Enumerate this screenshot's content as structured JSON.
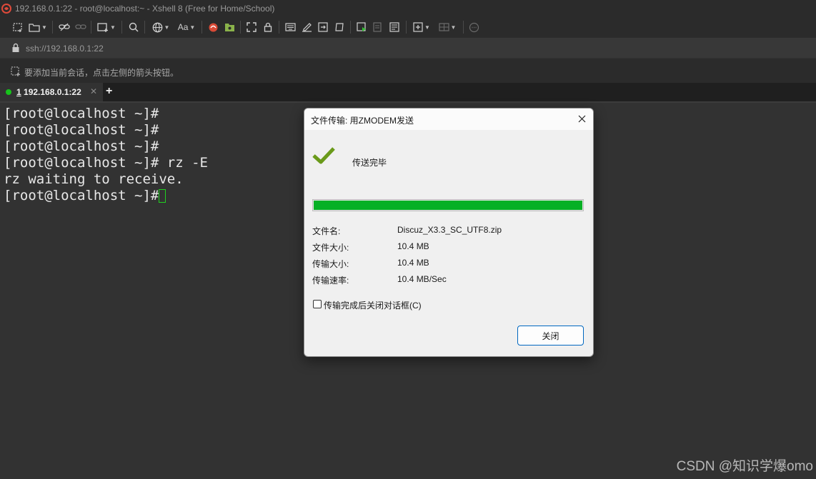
{
  "window": {
    "title": "192.168.0.1:22 - root@localhost:~ - Xshell 8 (Free for Home/School)"
  },
  "toolbar": {
    "font_label": "Aa",
    "buttons": [
      "new-session-icon",
      "open-folder-icon",
      "link-icon",
      "unlink-icon",
      "new-window-icon",
      "search-icon",
      "globe-icon",
      "font-icon",
      "xftp-icon",
      "xagent-icon",
      "fullscreen-icon",
      "lock-icon",
      "keyboard-icon",
      "compose-icon",
      "script-icon",
      "arrange-icon",
      "tunnel-icon",
      "log-icon",
      "notes-icon",
      "add-icon",
      "layout-icon",
      "chat-icon"
    ]
  },
  "addressbar": {
    "address": "ssh://192.168.0.1:22"
  },
  "hintbar": {
    "text": "要添加当前会话，点击左侧的箭头按钮。"
  },
  "tabs": [
    {
      "number": "1",
      "label": "192.168.0.1:22",
      "active": true,
      "status_color": "#17c31b"
    }
  ],
  "terminal": {
    "lines": [
      "[root@localhost ~]#",
      "[root@localhost ~]#",
      "[root@localhost ~]#",
      "[root@localhost ~]# rz -E",
      "rz waiting to receive.",
      "[root@localhost ~]# "
    ]
  },
  "dialog": {
    "title": "文件传输: 用ZMODEM发送",
    "status": "传送完毕",
    "progress": 1.0,
    "progress_color": "#06b025",
    "info": [
      {
        "label": "文件名:",
        "value": "Discuz_X3.3_SC_UTF8.zip"
      },
      {
        "label": "文件大小:",
        "value": "10.4 MB"
      },
      {
        "label": "传输大小:",
        "value": "10.4 MB"
      },
      {
        "label": "传输速率:",
        "value": "10.4 MB/Sec"
      }
    ],
    "auto_close_label": "传输完成后关闭对话框(C)",
    "auto_close_checked": false,
    "close_button": "关闭"
  },
  "watermark": "CSDN @知识学爆omo"
}
